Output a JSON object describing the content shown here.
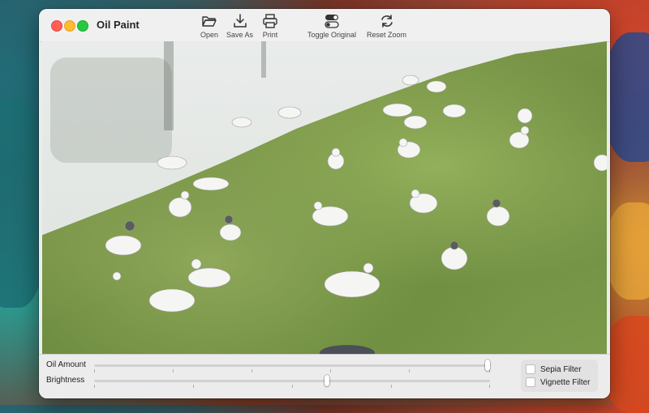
{
  "window": {
    "title": "Oil Paint"
  },
  "toolbar": {
    "open_label": "Open",
    "save_as_label": "Save As",
    "print_label": "Print",
    "toggle_original_label": "Toggle Original",
    "reset_zoom_label": "Reset Zoom"
  },
  "controls": {
    "oil_amount": {
      "label": "Oil Amount",
      "value_fraction": 1.0
    },
    "brightness": {
      "label": "Brightness",
      "value_fraction": 0.59
    }
  },
  "filters": {
    "sepia": {
      "label": "Sepia Filter",
      "checked": false
    },
    "vignette": {
      "label": "Vignette Filter",
      "checked": false
    }
  },
  "colors": {
    "close": "#ff5f57",
    "minimize": "#febc2e",
    "maximize": "#28c840"
  }
}
